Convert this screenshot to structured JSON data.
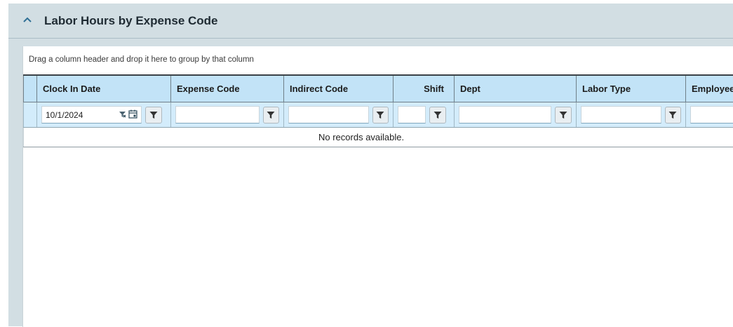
{
  "section": {
    "title": "Labor Hours by Expense Code"
  },
  "grid": {
    "group_hint": "Drag a column header and drop it here to group by that column",
    "columns": [
      {
        "label": "Clock In Date"
      },
      {
        "label": "Expense Code"
      },
      {
        "label": "Indirect Code"
      },
      {
        "label": "Shift"
      },
      {
        "label": "Dept"
      },
      {
        "label": "Labor Type"
      },
      {
        "label": "Employee"
      }
    ],
    "filters": {
      "clock_in_date": "10/1/2024"
    },
    "empty_message": "No records available."
  },
  "icons": {
    "collapse": "chevron-up-icon",
    "filter": "funnel-icon",
    "clear": "clear-filter-icon",
    "calendar": "calendar-icon"
  },
  "colors": {
    "header_bg": "#c2e3f7",
    "filter_bg": "#d3ecfb",
    "section_bg": "#d2dee3",
    "accent": "#2f6f95"
  }
}
